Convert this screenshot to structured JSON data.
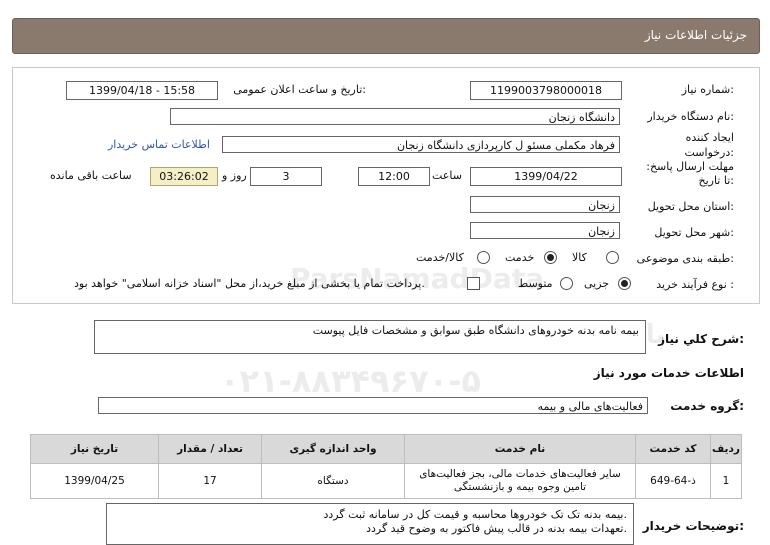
{
  "header": {
    "title": "جزئیات اطلاعات نیاز"
  },
  "fields": {
    "need_number_label": "شماره نیاز:",
    "need_number": "1199003798000018",
    "announce_label": "تاریخ و ساعت اعلان عمومی:",
    "announce_value": "1399/04/18 - 15:58",
    "buyer_label": "نام دستگاه خریدار:",
    "buyer_value": "دانشگاه زنجان",
    "creator_label": "ایجاد کننده درخواست:",
    "creator_value": "فرهاد مکملی مسئو ل کارپردازی دانشگاه زنجان",
    "contact_link": "اطلاعات تماس خریدار",
    "deadline_label": "مهلت ارسال پاسخ: تا تاریخ:",
    "deadline_date": "1399/04/22",
    "time_label": "ساعت",
    "deadline_time": "12:00",
    "days_value": "3",
    "days_label": "روز و",
    "timer_value": "03:26:02",
    "remaining_label": "ساعت باقی مانده",
    "province_label": "استان محل تحویل:",
    "province_value": "زنجان",
    "city_label": "شهر محل تحویل:",
    "city_value": "زنجان",
    "category_label": "طبقه بندی موضوعی:",
    "category_options": [
      "کالا",
      "خدمت",
      "کالا/خدمت"
    ],
    "process_label": "نوع فرآیند خرید :",
    "process_options": [
      "جزیی",
      "متوسط"
    ],
    "payment_text": "پرداخت تمام یا بخشی از مبلغ خرید،از محل \"اسناد خزانه اسلامی\" خواهد بود."
  },
  "summary": {
    "label": "شرح کلي نياز:",
    "value": "بیمه نامه بدنه خودروهای دانشگاه طبق سوابق و مشخصات فایل پیوست"
  },
  "services_title": "اطلاعات خدمات مورد نیاز",
  "service_group": {
    "label": "گروه خدمت:",
    "value": "فعالیت‌های مالی و بیمه"
  },
  "table": {
    "headers": [
      "ردیف",
      "کد خدمت",
      "نام خدمت",
      "واحد اندازه گیری",
      "تعداد / مقدار",
      "تاریخ نیاز"
    ],
    "rows": [
      [
        "1",
        "ذ-64-649",
        "سایر فعالیت‌های خدمات مالی، بجز فعالیت‌های تامین وجوه بیمه و بازنشستگی",
        "دستگاه",
        "17",
        "1399/04/25"
      ]
    ]
  },
  "buyer_notes": {
    "label": "توضیحات خریدار:",
    "line1": "بیمه بدنه تک تک خودروها محاسبه و قیمت کل در سامانه ثبت گردد.",
    "line2": "تعهدات بیمه بدنه در قالب پیش فاکتور به وضوح قید گردد."
  },
  "watermark": {
    "line1": "ParsNamadData",
    "line2": "پایگاه اطلاع رسانی مناقصه ومزایده",
    "line3": "۰۲۱-۸۸۳۴۹۶۷۰-۵"
  }
}
